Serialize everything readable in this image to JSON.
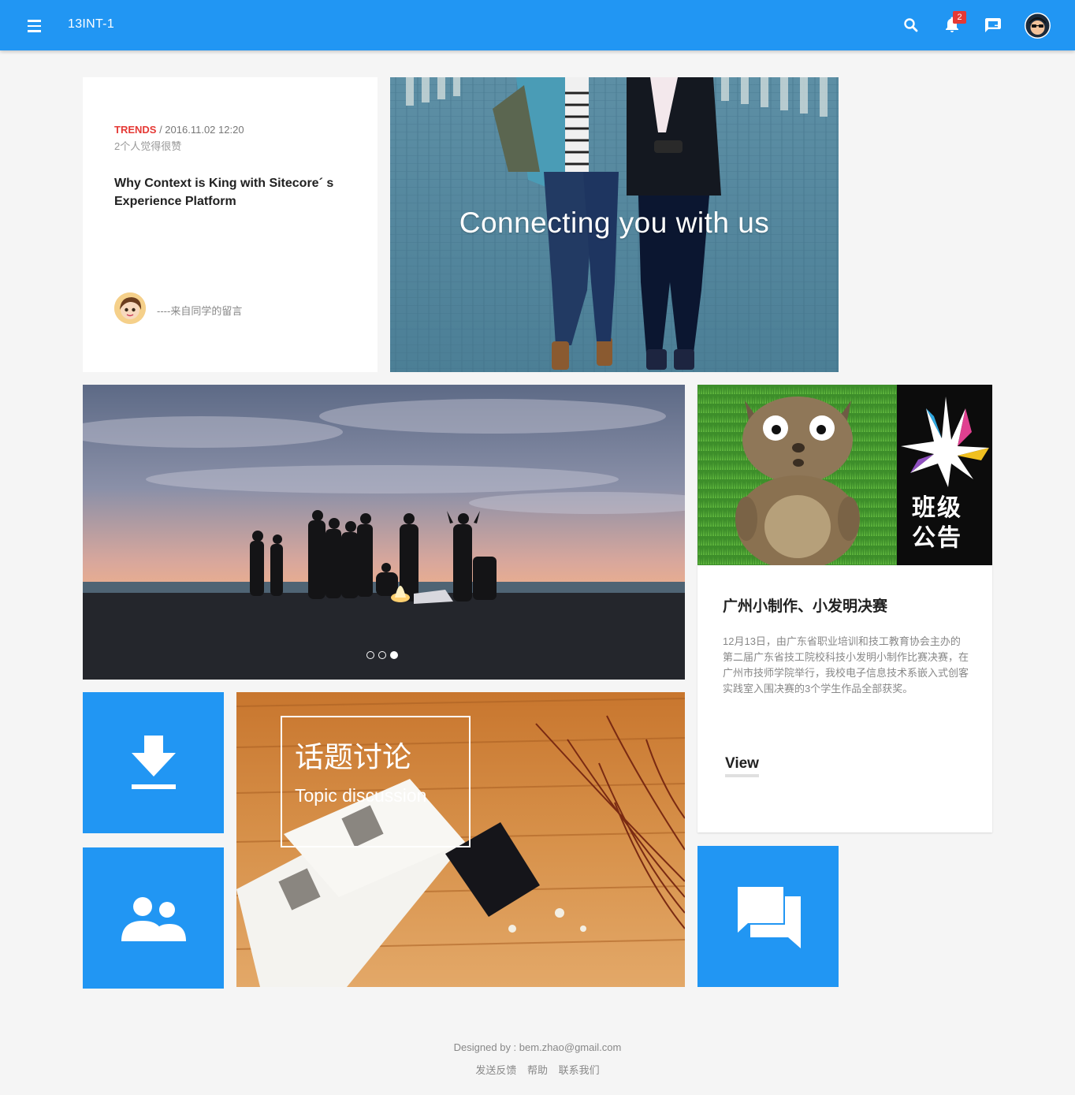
{
  "header": {
    "title": "13INT-1",
    "notification_count": "2",
    "accent_color": "#2196f3"
  },
  "news_card": {
    "tag": "TRENDS",
    "date": "/ 2016.11.02 12:20",
    "likes": "2个人觉得很赞",
    "title": "Why Context is King with Sitecore´ s Experience Platform",
    "from": "----来自同学的留言"
  },
  "hero": {
    "caption": "Connecting you with us"
  },
  "carousel": {
    "slide_count": 3,
    "active_slide": 3
  },
  "notice": {
    "badge_text": "班级公告",
    "title": "广州小制作、小发明决赛",
    "body": "12月13日，由广东省职业培训和技工教育协会主办的第二届广东省技工院校科技小发明小制作比赛决赛，在广州市技师学院举行，我校电子信息技术系嵌入式创客实践室入围决赛的3个学生作品全部获奖。",
    "link": "View"
  },
  "topic": {
    "title_zh": "话题讨论",
    "title_en": "Topic discussion"
  },
  "tiles": {
    "download_icon": "download-icon",
    "people_icon": "people-icon",
    "chat_icon": "chat-icon"
  },
  "footer": {
    "designed_by": "Designed by : bem.zhao@gmail.com",
    "links": [
      "发送反馈",
      "帮助",
      "联系我们"
    ]
  }
}
